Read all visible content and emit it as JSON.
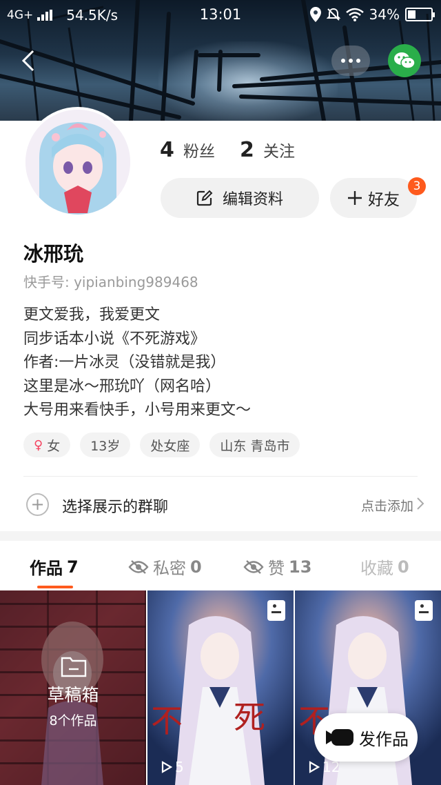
{
  "status_bar": {
    "network": "4G+",
    "speed": "54.5K/s",
    "time": "13:01",
    "battery": "34%",
    "battery_level": 0.34
  },
  "header": {
    "back_icon": "chevron-left-icon",
    "more_icon": "more-dots-icon",
    "share_icon": "wechat-icon"
  },
  "profile": {
    "followers_count": "4",
    "followers_label": "粉丝",
    "following_count": "2",
    "following_label": "关注",
    "edit_label": "编辑资料",
    "friend_label": "好友",
    "friend_badge": "3",
    "username": "冰邢玧",
    "user_id": "快手号: yipianbing989468",
    "bio": [
      "更文爱我，我爱更文",
      "同步话本小说《不死游戏》",
      "作者:一片冰灵（没错就是我）",
      "这里是冰～邢玧吖（网名哈）",
      "大号用来看快手，小号用来更文～"
    ],
    "tags": {
      "gender_symbol": "♀",
      "gender": "女",
      "age": "13岁",
      "zodiac": "处女座",
      "location": "山东 青岛市"
    }
  },
  "group_chat": {
    "label": "选择展示的群聊",
    "action": "点击添加"
  },
  "tabs": [
    {
      "label": "作品",
      "count": "7"
    },
    {
      "label": "私密",
      "count": "0"
    },
    {
      "label": "赞",
      "count": "13"
    },
    {
      "label": "收藏",
      "count": "0"
    }
  ],
  "grid": {
    "draft_title": "草稿箱",
    "draft_count": "8个作品",
    "items": [
      {
        "plays": "5"
      },
      {
        "plays": "12"
      }
    ]
  },
  "post_button": {
    "label": "发作品"
  },
  "colors": {
    "accent": "#fe5a1d",
    "wechat": "#2aae4a"
  }
}
